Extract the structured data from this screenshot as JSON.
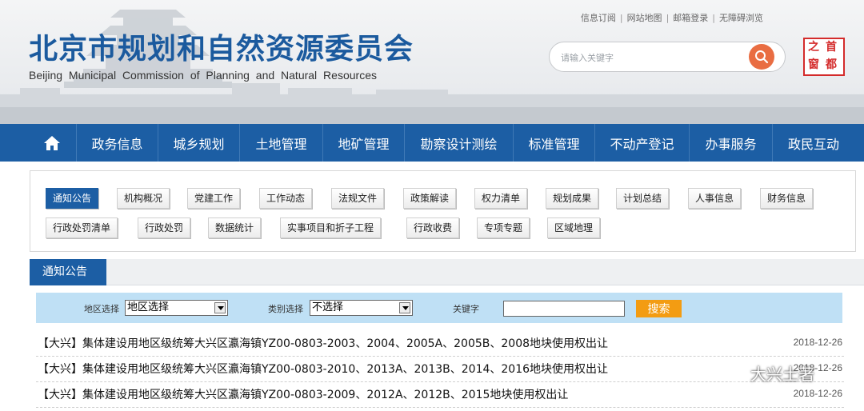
{
  "header": {
    "title_cn": "北京市规划和自然资源委员会",
    "title_en": "Beijing Municipal Commission of Planning and Natural Resources",
    "toplinks": [
      "信息订阅",
      "网站地图",
      "邮箱登录",
      "无障碍浏览"
    ],
    "search_placeholder": "请输入关键字",
    "seal_chars": [
      "之",
      "首",
      "窗",
      "都"
    ]
  },
  "nav": [
    "政务信息",
    "城乡规划",
    "土地管理",
    "地矿管理",
    "勘察设计测绘",
    "标准管理",
    "不动产登记",
    "办事服务",
    "政民互动"
  ],
  "categories": {
    "row1": [
      "通知公告",
      "机构概况",
      "党建工作",
      "工作动态",
      "法规文件",
      "政策解读",
      "权力清单",
      "规划成果",
      "计划总结",
      "人事信息",
      "财务信息"
    ],
    "row2": [
      "行政处罚清单",
      "行政处罚",
      "数据统计",
      "实事项目和折子工程",
      "行政收费",
      "专项专题",
      "区域地理"
    ],
    "active": "通知公告"
  },
  "tab": {
    "label": "通知公告"
  },
  "filter": {
    "region_label": "地区选择",
    "region_value": "地区选择",
    "type_label": "类别选择",
    "type_value": "不选择",
    "keyword_label": "关键字",
    "keyword_value": "",
    "search_button": "搜索"
  },
  "list": [
    {
      "title": "【大兴】集体建设用地区级统筹大兴区瀛海镇YZ00-0803-2003、2004、2005A、2005B、2008地块使用权出让",
      "date": "2018-12-26"
    },
    {
      "title": "【大兴】集体建设用地区级统筹大兴区瀛海镇YZ00-0803-2010、2013A、2013B、2014、2016地块使用权出让",
      "date": "2018-12-26"
    },
    {
      "title": "【大兴】集体建设用地区级统筹大兴区瀛海镇YZ00-0803-2009、2012A、2012B、2015地块使用权出让",
      "date": "2018-12-26"
    }
  ],
  "watermark": {
    "text": "大兴土著"
  },
  "colors": {
    "brand_blue": "#1c5ea4",
    "search_orange": "#e96d42",
    "button_orange": "#f39c12",
    "filter_bg": "#bfe0f5",
    "seal_red": "#d42b2b"
  }
}
